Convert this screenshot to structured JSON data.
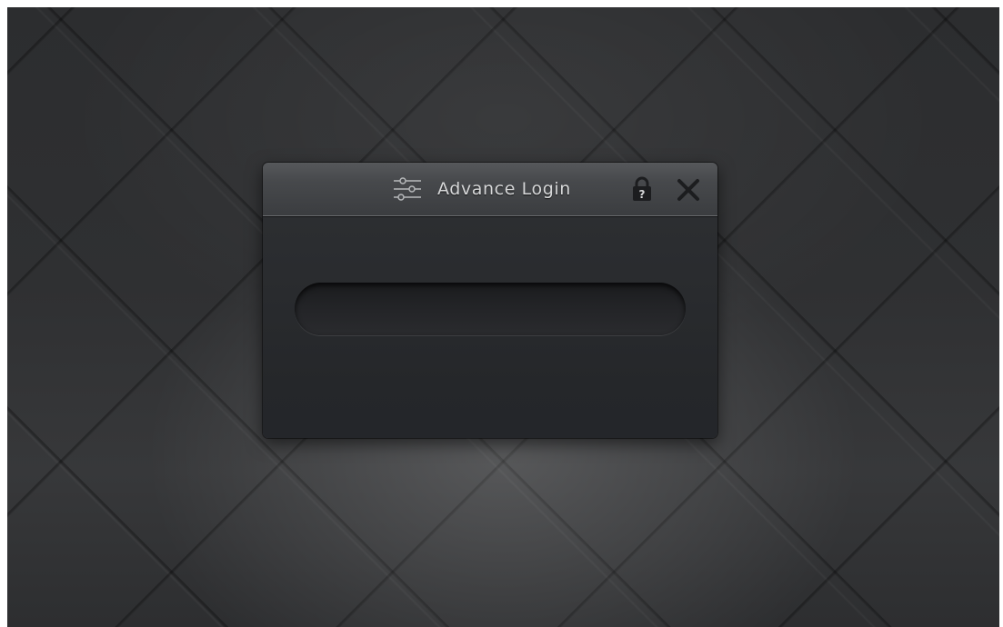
{
  "dialog": {
    "title": "Advance Login",
    "title_icon": "sliders-icon",
    "lock_icon": "lock-help-icon",
    "lock_badge": "?",
    "close_icon": "close-icon"
  },
  "field": {
    "value": "",
    "placeholder": ""
  },
  "colors": {
    "background": "#2e2f31",
    "titlebar": "#47494c",
    "dialog_body": "#26282b",
    "title_text": "#d6d7d8",
    "icon": "#1c1d1f"
  }
}
